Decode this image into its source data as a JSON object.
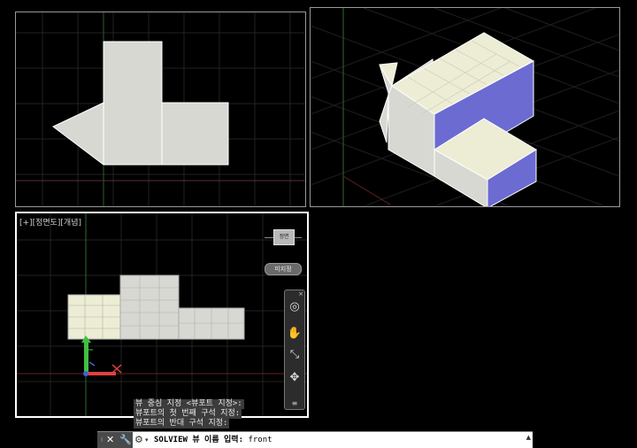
{
  "viewports": {
    "active": {
      "label": "[+][정면도][개념]",
      "viewcube_label": "정면",
      "wcs_label": "미지정"
    }
  },
  "navbar": {
    "icons": [
      "steering-wheel-icon",
      "pan-icon",
      "zoom-extents-icon",
      "orbit-icon"
    ]
  },
  "command": {
    "history": [
      "뷰 중심 지정 <뷰포트 지정>:",
      "뷰포트의 첫 번째 구석 지정:",
      "뷰포트의 반대 구석 지정:"
    ],
    "prompt": "SOLVIEW 뷰 이름 입력:",
    "value": "front"
  },
  "colors": {
    "face_grey": "#d8d8d3",
    "face_cream": "#ededd5",
    "face_blue": "#6b6bd2",
    "ucs_x": "#e04040",
    "ucs_y": "#40c040",
    "ucs_z": "#4060e0"
  }
}
